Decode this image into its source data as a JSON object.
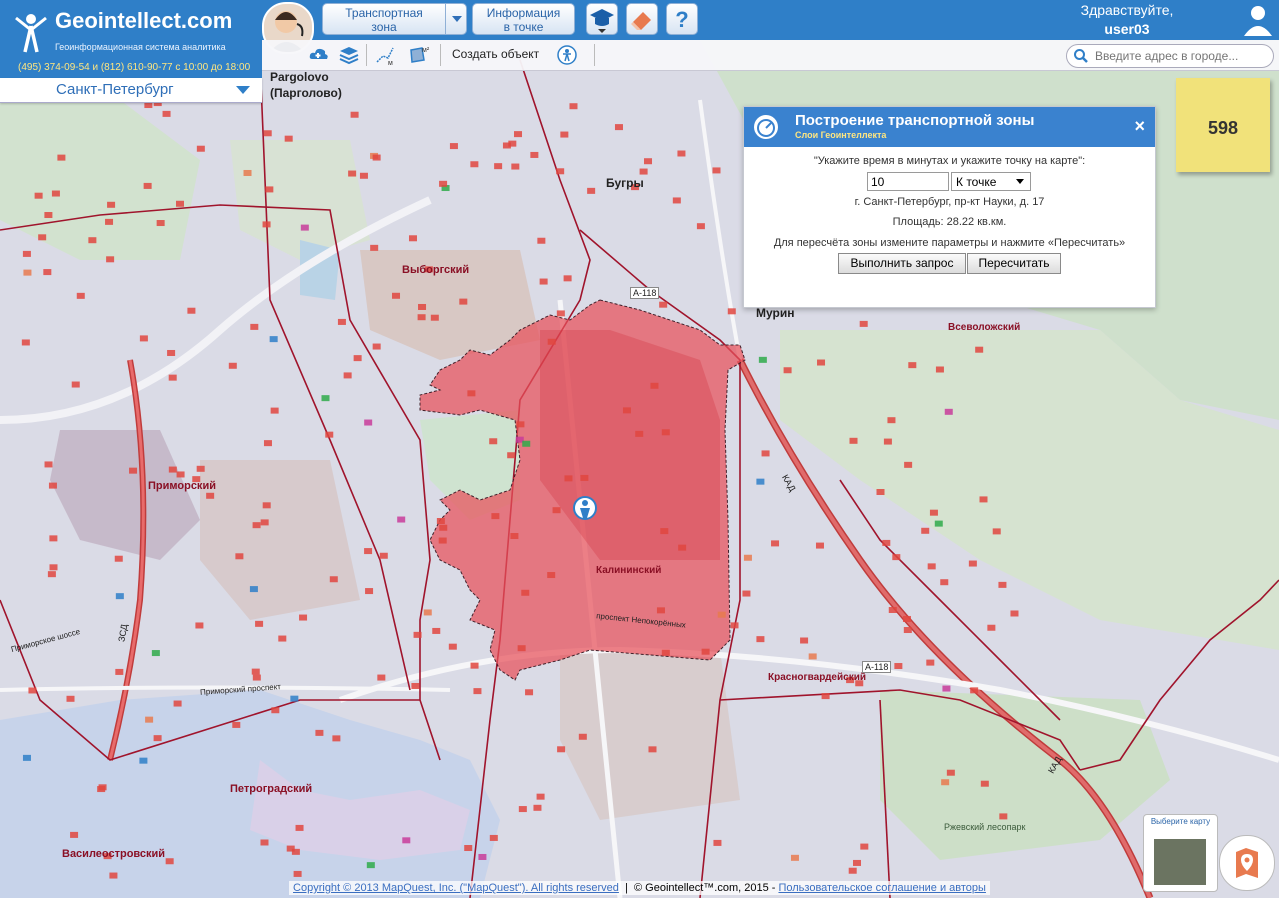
{
  "header": {
    "logo_title": "Geointellect.com",
    "logo_subtitle": "Геоинформационная система аналитика",
    "logo_phone": "(495) 374-09-54 и (812) 610-90-77 с 10:00 до 18:00",
    "city": "Санкт-Петербург",
    "btn_transport_zone": "Транспортная\nзона",
    "btn_info_point": "Информация\nв точке",
    "greeting": "Здравствуйте,",
    "username": "user03"
  },
  "toolbar": {
    "create_object": "Создать объект",
    "search_placeholder": "Введите адрес в городе..."
  },
  "dialog": {
    "title": "Построение транспортной зоны",
    "subtitle": "Слои Геоинтеллекта",
    "prompt": "\"Укажите время в минутах и укажите точку на карте\":",
    "minutes": "10",
    "direction": "К точке",
    "address": "г. Санкт-Петербург, пр-кт Науки, д. 17",
    "area": "Площадь: 28.22 кв.км.",
    "hint": "Для пересчёта зоны измените параметры и нажмите «Пересчитать»",
    "btn_execute": "Выполнить запрос",
    "btn_recalc": "Пересчитать"
  },
  "sticky_count": "598",
  "map_labels": {
    "pargolovo1": "Pargolovo",
    "pargolovo2": "(Парголово)",
    "bugry": "Бугры",
    "murino": "Мурин",
    "vyborgsky": "Выборгский",
    "vsevolozhsky": "Всеволожский",
    "primorsky": "Приморский",
    "kalininsky": "Калининский",
    "krasnogvardeysky": "Красногвардейский",
    "petrogradsky": "Петроградский",
    "vasileostrovsky": "Василеостровский",
    "rzhevsky": "Ржевский лесопарк",
    "a118_top": "А-118",
    "a118_mid": "А-118",
    "kad1": "КАД",
    "kad2": "КАД",
    "primorskoe": "Приморское шоссе",
    "primorsky_pr": "Приморский проспект",
    "nepokorennyh": "проспект Непокорённых",
    "zsd": "ЗСД"
  },
  "footer": {
    "copyright_mq": "Copyright © 2013 MapQuest, Inc. (\"MapQuest\"). All rights reserved",
    "copyright_gi": "© Geointellect™.com, 2015 -",
    "terms": "Пользовательское соглашение и авторы"
  },
  "choose_map": "Выберите карту",
  "colors": {
    "header_blue": "#2f7fc8",
    "zone_fill": "#e8505a",
    "boundary": "#a0142c",
    "sticky": "#f1e27a"
  }
}
